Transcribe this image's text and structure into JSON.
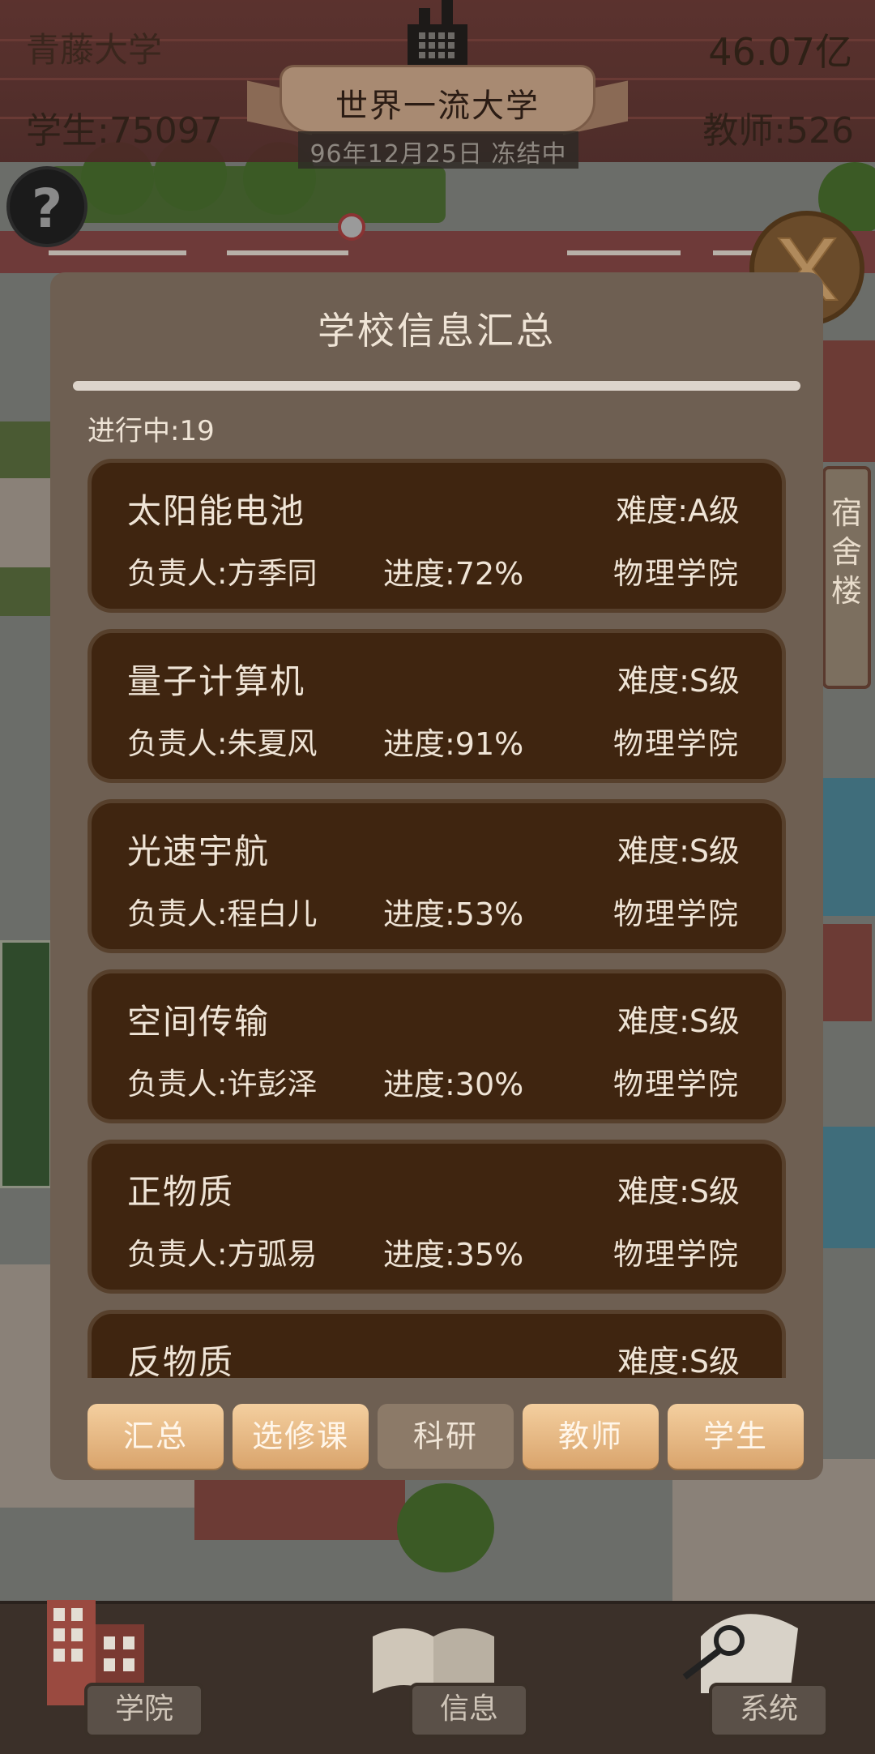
{
  "hud": {
    "school_name": "青藤大学",
    "money": "46.07亿",
    "rank_title": "世界一流大学",
    "students": "学生:75097",
    "teachers": "教师:526",
    "date_status": "96年12月25日 冻结中"
  },
  "help": {
    "label": "?"
  },
  "panel": {
    "title": "学校信息汇总",
    "in_progress": "进行中:19",
    "projects": [
      {
        "name": "太阳能电池",
        "difficulty": "难度:A级",
        "leader": "负责人:方季同",
        "progress": "进度:72%",
        "department": "物理学院"
      },
      {
        "name": "量子计算机",
        "difficulty": "难度:S级",
        "leader": "负责人:朱夏风",
        "progress": "进度:91%",
        "department": "物理学院"
      },
      {
        "name": "光速宇航",
        "difficulty": "难度:S级",
        "leader": "负责人:程白儿",
        "progress": "进度:53%",
        "department": "物理学院"
      },
      {
        "name": "空间传输",
        "difficulty": "难度:S级",
        "leader": "负责人:许彭泽",
        "progress": "进度:30%",
        "department": "物理学院"
      },
      {
        "name": "正物质",
        "difficulty": "难度:S级",
        "leader": "负责人:方弧易",
        "progress": "进度:35%",
        "department": "物理学院"
      },
      {
        "name": "反物质",
        "difficulty": "难度:S级",
        "leader": "",
        "progress": "",
        "department": ""
      }
    ],
    "tabs": [
      "汇总",
      "选修课",
      "科研",
      "教师",
      "学生"
    ],
    "active_tab": "科研"
  },
  "dorm_sign": "宿舍楼",
  "bottom_nav": {
    "college": "学院",
    "info": "信息",
    "system": "系统"
  },
  "colors": {
    "panel_bg": "#6e5f52",
    "card_bg": "#3f2510",
    "tab_gold": "#e8b884",
    "tab_active": "#8c7a68",
    "text_light": "#efe4d6"
  }
}
